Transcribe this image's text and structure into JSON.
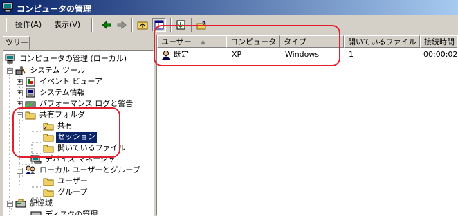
{
  "window": {
    "title": "コンピュータの管理"
  },
  "menu": {
    "action": "操作(A)",
    "view": "表示(V)"
  },
  "tree": {
    "tab": "ツリー",
    "nodes": [
      {
        "label": "コンピュータの管理 (ローカル)"
      },
      {
        "label": "システム ツール"
      },
      {
        "label": "イベント ビューア"
      },
      {
        "label": "システム情報"
      },
      {
        "label": "パフォーマンス ログと警告"
      },
      {
        "label": "共有フォルダ"
      },
      {
        "label": "共有"
      },
      {
        "label": "セッション"
      },
      {
        "label": "開いているファイル"
      },
      {
        "label": "デバイス マネージャ"
      },
      {
        "label": "ローカル ユーザーとグループ"
      },
      {
        "label": "ユーザー"
      },
      {
        "label": "グループ"
      },
      {
        "label": "記憶域"
      },
      {
        "label": "ディスクの管理"
      }
    ]
  },
  "list": {
    "columns": [
      "ユーザー",
      "コンピュータ",
      "タイプ",
      "開いているファイル",
      "接続時間"
    ],
    "rows": [
      {
        "user": "既定",
        "computer": "XP",
        "type": "Windows",
        "open_files": "1",
        "connected": "00:00:02"
      }
    ]
  },
  "colors": {
    "highlight": "#e0202e",
    "selection": "#0a246a",
    "titlebar": "#0a246a"
  },
  "icons": [
    "computer-icon",
    "back-icon",
    "forward-icon",
    "up-folder-icon",
    "show-tree-icon",
    "export-icon",
    "help-icon",
    "tools-icon",
    "event-viewer-icon",
    "system-info-icon",
    "performance-icon",
    "folder-icon",
    "device-manager-icon",
    "users-groups-icon",
    "storage-icon",
    "disk-icon",
    "user-session-icon"
  ]
}
